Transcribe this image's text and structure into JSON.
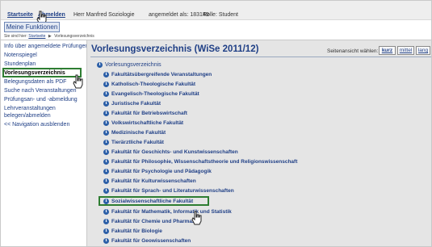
{
  "header": {
    "startseite": "Startseite",
    "abmelden": "Abmelden",
    "user": "Herr Manfred Soziologie",
    "login_label": "angemeldet als: 183149",
    "role": "Rolle: Student"
  },
  "meine_funktionen": "Meine Funktionen",
  "breadcrumb": {
    "prefix": "Sie sind hier:",
    "home": "Startseite",
    "current": "Vorlesungsverzeichnis"
  },
  "sidebar": {
    "items": [
      {
        "label": "Info über angemeldete Prüfungen"
      },
      {
        "label": "Notenspiegel"
      },
      {
        "label": "Stundenplan"
      },
      {
        "label": "Vorlesungsverzeichnis"
      },
      {
        "label": "Belegungsdaten als PDF"
      },
      {
        "label": "Suche nach Veranstaltungen"
      },
      {
        "label": "Prüfungsan- und -abmeldung"
      },
      {
        "label": "Lehrveranstaltungen"
      },
      {
        "label": "belegen/abmelden"
      },
      {
        "label": "<< Navigation ausblenden"
      }
    ]
  },
  "main": {
    "title": "Vorlesungsverzeichnis (WiSe 2011/12)",
    "view_label": "Seitenansicht wählen:",
    "view_options": [
      "kurz",
      "mittel",
      "lang"
    ],
    "root_label": "Vorlesungsverzeichnis",
    "tree": [
      "Fakultätsübergreifende Veranstaltungen",
      "Katholisch-Theologische Fakultät",
      "Evangelisch-Theologische Fakultät",
      "Juristische Fakultät",
      "Fakultät für Betriebswirtschaft",
      "Volkswirtschaftliche Fakultät",
      "Medizinische Fakultät",
      "Tierärztliche Fakultät",
      "Fakultät für Geschichts- und Kunstwissenschaften",
      "Fakultät für Philosophie, Wissenschaftstheorie und Religionswissenschaft",
      "Fakultät für Psychologie und Pädagogik",
      "Fakultät für Kulturwissenschaften",
      "Fakultät für Sprach- und Literaturwissenschaften",
      "Sozialwissenschaftliche Fakultät",
      "Fakultät für Mathematik, Informatik und Statistik",
      "Fakultät für Chemie und Pharmazie",
      "Fakultät für Biologie",
      "Fakultät für Geowissenschaften"
    ]
  },
  "icons": {
    "info": "info-icon",
    "cursor": "hand-cursor-icon",
    "breadcrumb_arrow": "chevron-right-icon"
  },
  "colors": {
    "link": "#1f3f86",
    "highlight": "#2e7d32",
    "main_bg": "#e5e5e5",
    "info_icon": "#2b5ea7"
  }
}
